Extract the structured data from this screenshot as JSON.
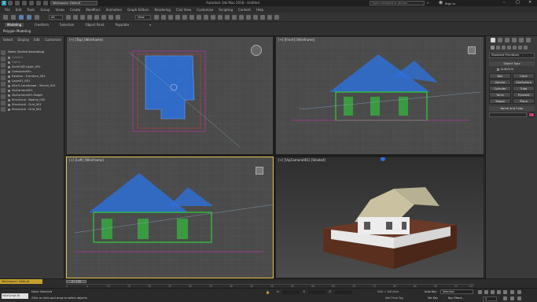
{
  "window": {
    "title": "Autodesk 3ds Max 2018 - Untitled",
    "workspace_label": "Workspace: Default",
    "search_placeholder": "Type a keyword or phrase",
    "sign_in": "Sign In"
  },
  "menu": [
    "File",
    "Edit",
    "Tools",
    "Group",
    "Views",
    "Create",
    "Modifiers",
    "Animation",
    "Graph Editors",
    "Rendering",
    "Civil View",
    "Customize",
    "Scripting",
    "Content",
    "Help"
  ],
  "toolbar": {
    "selection_filter": "All",
    "view_dropdown": "View"
  },
  "ribbon": {
    "tabs": [
      "Modeling",
      "Freeform",
      "Selection",
      "Object Paint",
      "Populate"
    ],
    "sub_label": "Polygon Modeling"
  },
  "scene_explorer": {
    "tabs": [
      "Select",
      "Display",
      "Edit",
      "Customize"
    ],
    "header": "Name (Sorted Ascending)",
    "items": [
      "Camera",
      "Lights",
      "ArchiCAD Layer_001",
      "CompoundOn",
      "Exterior - Furniture_002",
      "Layer01_001",
      "Site & Landscape - Terrain_001",
      "VipCamera001",
      "VipCamera001.Target",
      "Structural - Beams_002",
      "Structural - Grid_001",
      "Structural - Grid_002"
    ]
  },
  "viewports": {
    "top": "[+] [Top] [Wireframe]",
    "front": "[+] [Front] [Wireframe]",
    "left": "[+] [Left] [Wireframe]",
    "camera": "[+] [VipCamera001] [Shaded]"
  },
  "command_panel": {
    "dropdown": "Standard Primitives",
    "rollout_object_type": "Object Type",
    "autogrid": "AutoGrid",
    "buttons": [
      "Box",
      "Cone",
      "Sphere",
      "GeoSphere",
      "Cylinder",
      "Tube",
      "Torus",
      "Pyramid",
      "Teapot",
      "Plane"
    ],
    "rollout_name_color": "Name and Color",
    "color": "#c0407a"
  },
  "timeline": {
    "frame_display": "0 / 100",
    "ticks": [
      "0",
      "5",
      "10",
      "15",
      "20",
      "25",
      "30",
      "35",
      "40",
      "45",
      "50",
      "55",
      "60",
      "65",
      "70",
      "75",
      "80",
      "85",
      "90",
      "95",
      "100"
    ]
  },
  "status": {
    "workspace_badge": "Workspace: Default",
    "maxscript": "MAXScript Mi",
    "none_selected": "None Selected",
    "prompt": "Click or click-and-drag to select objects",
    "grid": "Grid = 100,0cm",
    "add_time_tag": "Add Time Tag",
    "autokey": "Auto Key",
    "selected": "Selected",
    "set_key": "Set Key",
    "key_filters": "Key Filters...",
    "frame": "0"
  },
  "colors": {
    "accent": "#e6c34a",
    "wire_blue": "#2e6fd6",
    "wire_green": "#2fcf3a",
    "brand_teal": "#2f9ab5"
  }
}
